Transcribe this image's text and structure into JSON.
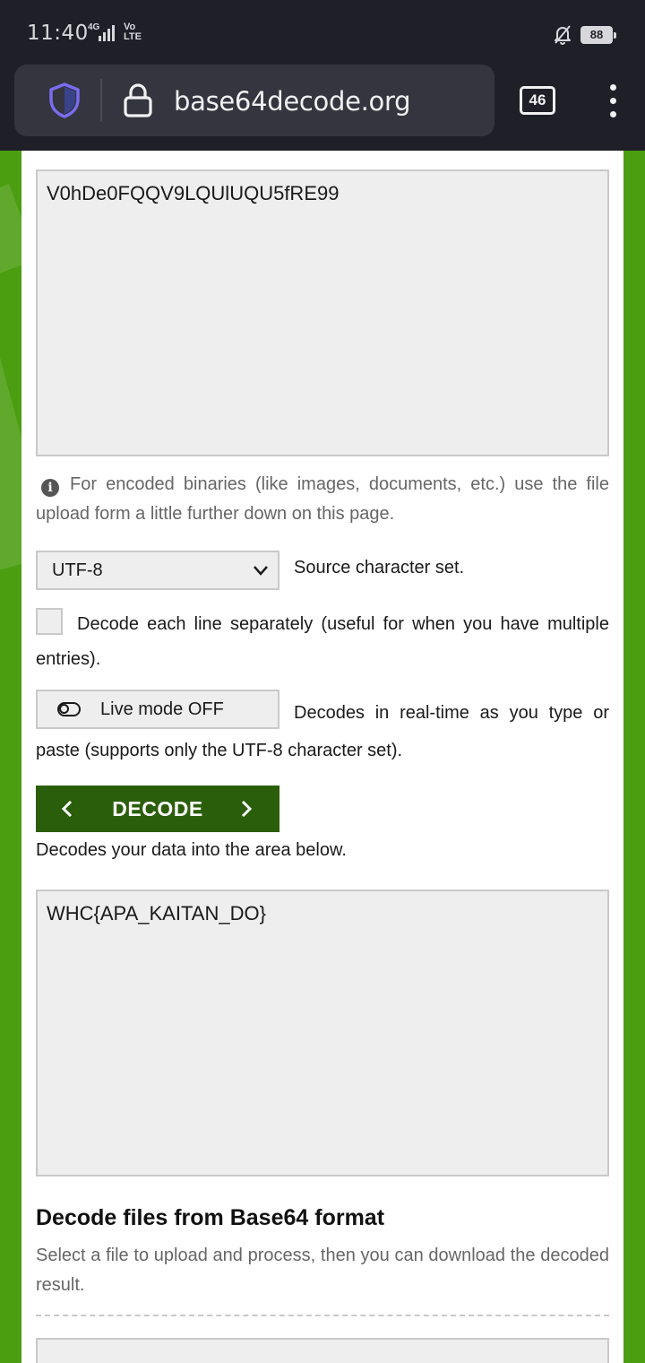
{
  "status_bar": {
    "time": "11:40",
    "network": "4G",
    "volte_top": "Vo",
    "volte_bottom": "LTE",
    "battery": "88"
  },
  "browser": {
    "url": "base64decode.org",
    "tab_count": "46"
  },
  "encoded_input": {
    "value": "V0hDe0FQQV9LQUlUQU5fRE99"
  },
  "binary_note": "For encoded binaries (like images, documents, etc.) use the file upload form a little further down on this page.",
  "charset": {
    "selected": "UTF-8",
    "caption": "Source character set."
  },
  "line_option": {
    "label": "Decode each line separately (useful for when you have multiple entries)."
  },
  "live_mode": {
    "label": "Live mode OFF",
    "caption": "Decodes in real-time as you type or paste (supports only the UTF-8 character set)."
  },
  "decode": {
    "label": "DECODE",
    "caption": "Decodes your data into the area below."
  },
  "decoded_output": {
    "value": "WHC{APA_KAITAN_DO}"
  },
  "file_section": {
    "title": "Decode files from Base64 format",
    "description": "Select a file to upload and process, then you can download the decoded result."
  },
  "colors": {
    "page_green": "#4a9e10",
    "button_green": "#2b5e0a",
    "browser_dark": "#1f1f27"
  }
}
